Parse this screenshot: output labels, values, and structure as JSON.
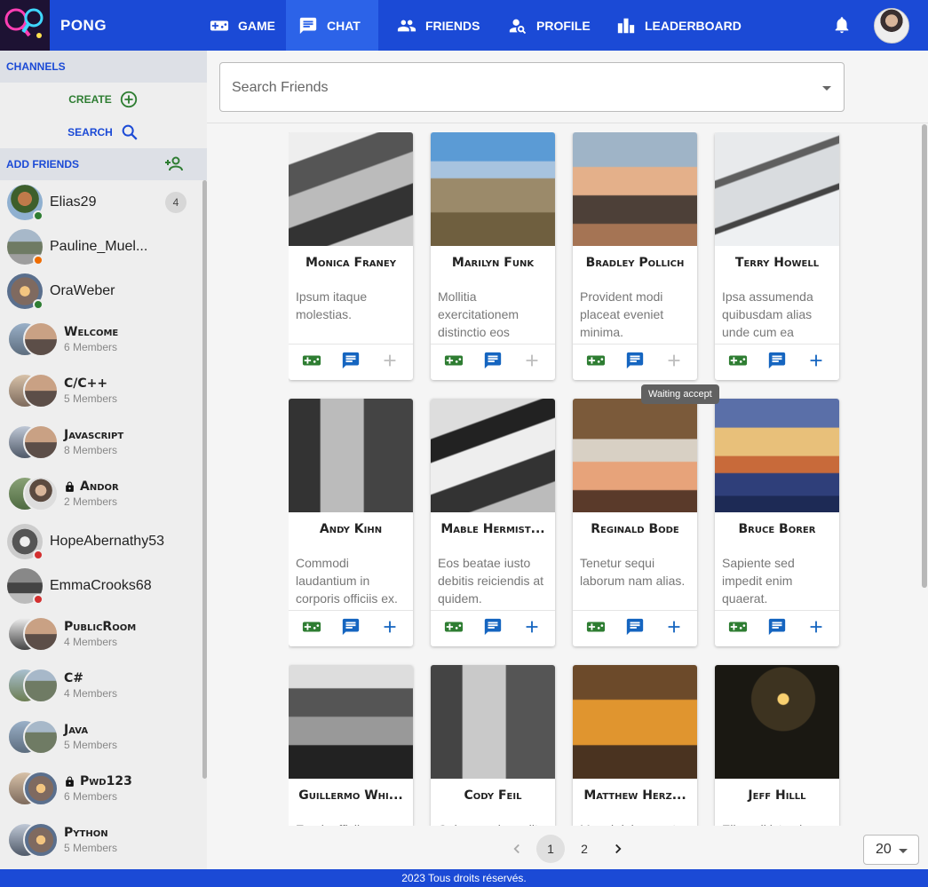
{
  "app": {
    "brand": "PONG"
  },
  "nav": {
    "items": [
      {
        "label": "GAME",
        "icon": "gamepad-icon"
      },
      {
        "label": "CHAT",
        "icon": "chat-icon",
        "active": true
      },
      {
        "label": "FRIENDS",
        "icon": "people-icon"
      },
      {
        "label": "PROFILE",
        "icon": "person-search-icon"
      },
      {
        "label": "LEADERBOARD",
        "icon": "leaderboard-icon"
      }
    ],
    "notifications_icon": "bell-icon"
  },
  "sidebar": {
    "channels_label": "CHANNELS",
    "create_label": "CREATE",
    "search_label": "SEARCH",
    "add_friends_label": "ADD FRIENDS",
    "friends": [
      {
        "name": "Elias29",
        "status": "online",
        "status_color": "#2e7d32",
        "unread": "4"
      },
      {
        "name": "Pauline_Muel...",
        "status": "away",
        "status_color": "#ef6c00"
      },
      {
        "name": "OraWeber",
        "status": "online",
        "status_color": "#2e7d32"
      },
      {
        "name": "HopeAbernathy53",
        "status": "offline",
        "status_color": "#d32f2f"
      },
      {
        "name": "EmmaCrooks68",
        "status": "offline",
        "status_color": "#d32f2f"
      }
    ],
    "channels": [
      {
        "name": "Welcome",
        "members": "6 Members",
        "locked": false
      },
      {
        "name": "C/C++",
        "members": "5 Members",
        "locked": false
      },
      {
        "name": "Javascript",
        "members": "8 Members",
        "locked": false
      },
      {
        "name": "Andor",
        "members": "2 Members",
        "locked": true
      },
      {
        "name": "PublicRoom",
        "members": "4 Members",
        "locked": false
      },
      {
        "name": "C#",
        "members": "4 Members",
        "locked": false
      },
      {
        "name": "Java",
        "members": "5 Members",
        "locked": false
      },
      {
        "name": "Pwd123",
        "members": "6 Members",
        "locked": true
      },
      {
        "name": "Python",
        "members": "5 Members",
        "locked": false
      }
    ]
  },
  "search": {
    "placeholder": "Search Friends"
  },
  "cards": [
    {
      "name": "Monica Franey",
      "desc": "Ipsum itaque molestias.",
      "add_state": "disabled"
    },
    {
      "name": "Marilyn Funk",
      "desc": "Mollitia exercitationem distinctio eos",
      "add_state": "disabled"
    },
    {
      "name": "Bradley Pollich",
      "desc": "Provident modi placeat eveniet minima.",
      "add_state": "disabled"
    },
    {
      "name": "Terry Howell",
      "desc": "Ipsa assumenda quibusdam alias unde cum ea",
      "add_state": "active"
    },
    {
      "name": "Andy Kihn",
      "desc": "Commodi laudantium in corporis officiis ex.",
      "add_state": "active"
    },
    {
      "name": "Mable Hermist...",
      "desc": "Eos beatae iusto debitis reiciendis at quidem.",
      "add_state": "active"
    },
    {
      "name": "Reginald Bode",
      "desc": "Tenetur sequi laborum nam alias.",
      "add_state": "active"
    },
    {
      "name": "Bruce Borer",
      "desc": "Sapiente sed impedit enim quaerat.",
      "add_state": "active"
    },
    {
      "name": "Guillermo Whi...",
      "desc": "Ea ab officiis",
      "add_state": "active"
    },
    {
      "name": "Cody Feil",
      "desc": "Quisquam impedit",
      "add_state": "active"
    },
    {
      "name": "Matthew Herz...",
      "desc": "Magni dolorem et",
      "add_state": "active"
    },
    {
      "name": "Jeff Hilll",
      "desc": "Eligendi iste ab",
      "add_state": "active"
    }
  ],
  "tooltip": "Waiting accept",
  "pagination": {
    "pages": [
      "1",
      "2"
    ],
    "current": "1",
    "per_page": "20"
  },
  "footer": "2023 Tous droits réservés.",
  "colors": {
    "primary": "#1b4ad6",
    "game_icon": "#2e7d32",
    "chat_icon": "#1565c0",
    "add_disabled": "#bdbdbd"
  }
}
